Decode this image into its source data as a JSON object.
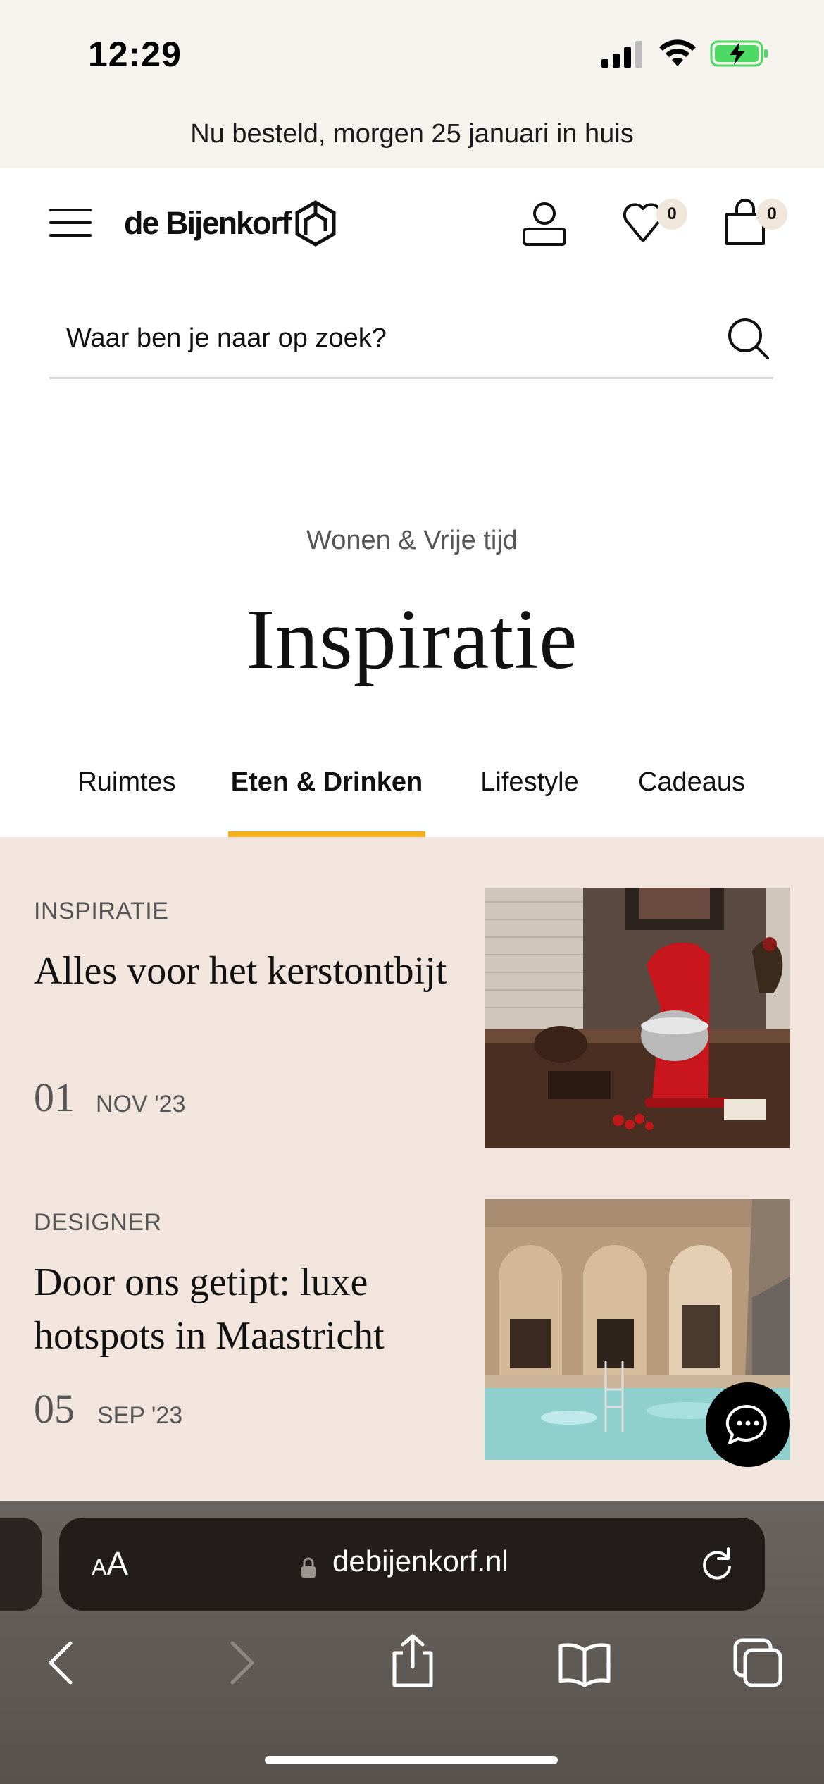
{
  "status_bar": {
    "time": "12:29"
  },
  "promo_banner": "Nu besteld, morgen 25 januari in huis",
  "header": {
    "logo_text": "de Bijenkorf",
    "wishlist_count": "0",
    "bag_count": "0"
  },
  "search": {
    "placeholder": "Waar ben je naar op zoek?"
  },
  "hero": {
    "breadcrumb": "Wonen & Vrije tijd",
    "title": "Inspiratie"
  },
  "tabs": [
    {
      "label": "Ruimtes",
      "active": false
    },
    {
      "label": "Eten & Drinken",
      "active": true
    },
    {
      "label": "Lifestyle",
      "active": false
    },
    {
      "label": "Cadeaus",
      "active": false
    }
  ],
  "articles": [
    {
      "category": "INSPIRATIE",
      "title": "Alles voor het kerstontbijt",
      "day": "01",
      "month": "NOV '23"
    },
    {
      "category": "DESIGNER",
      "title": "Door ons getipt: luxe hotspots in Maastricht",
      "day": "05",
      "month": "SEP '23"
    }
  ],
  "browser": {
    "text_size_label_small": "A",
    "text_size_label_large": "A",
    "url": "debijenkorf.nl"
  },
  "colors": {
    "accent": "#f2b01e",
    "content_bg": "#f1e5dd",
    "status_bg": "#f6f2ee",
    "battery": "#4cd964"
  }
}
